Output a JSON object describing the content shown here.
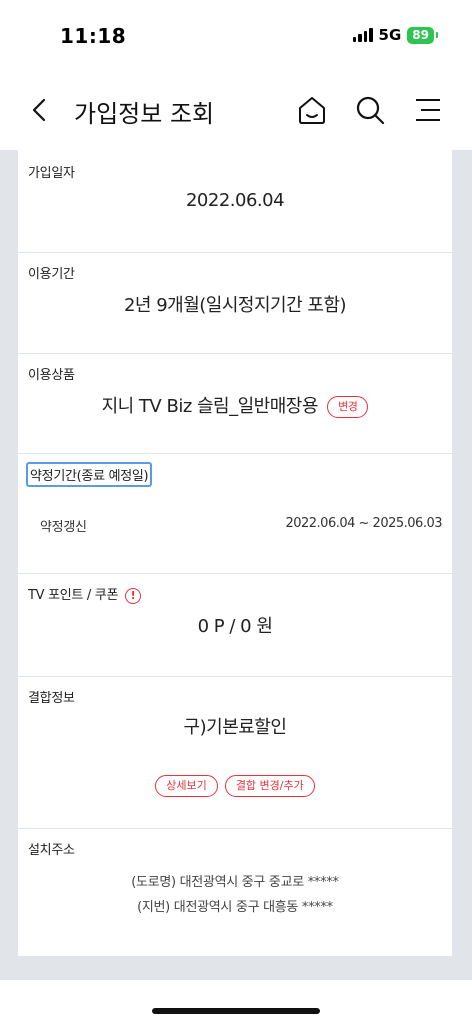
{
  "status_bar": {
    "time": "11:18",
    "network": "5G",
    "battery": "89"
  },
  "nav": {
    "title": "가입정보 조회",
    "icons": [
      "back-chevron-icon",
      "home-icon",
      "search-icon",
      "menu-icon"
    ]
  },
  "sections": {
    "join_date": {
      "label": "가입일자",
      "value": "2022.06.04"
    },
    "usage_period": {
      "label": "이용기간",
      "value": "2년 9개월(일시정지기간 포함)"
    },
    "product": {
      "label": "이용상품",
      "value": "지니 TV Biz 슬림_일반매장용",
      "change_button": "변경"
    },
    "contract": {
      "label": "약정기간(종료 예정일)",
      "row_label": "약정갱신",
      "row_value": "2022.06.04 ~ 2025.06.03"
    },
    "points": {
      "label": "TV 포인트 / 쿠폰",
      "info_icon": "!",
      "value": "0 P / 0 원"
    },
    "bundle": {
      "label": "결합정보",
      "value": "구)기본료할인",
      "detail_button": "상세보기",
      "change_button": "결합 변경/추가"
    },
    "address": {
      "label": "설치주소",
      "road": "(도로명) 대전광역시 중구 중교로 *****",
      "lot": "(지번) 대전광역시 중구 대흥동 *****"
    }
  },
  "colors": {
    "accent": "#e8323c",
    "page_bg": "#e1e5ea",
    "battery": "#2fc452",
    "focus": "#5b9be6"
  }
}
